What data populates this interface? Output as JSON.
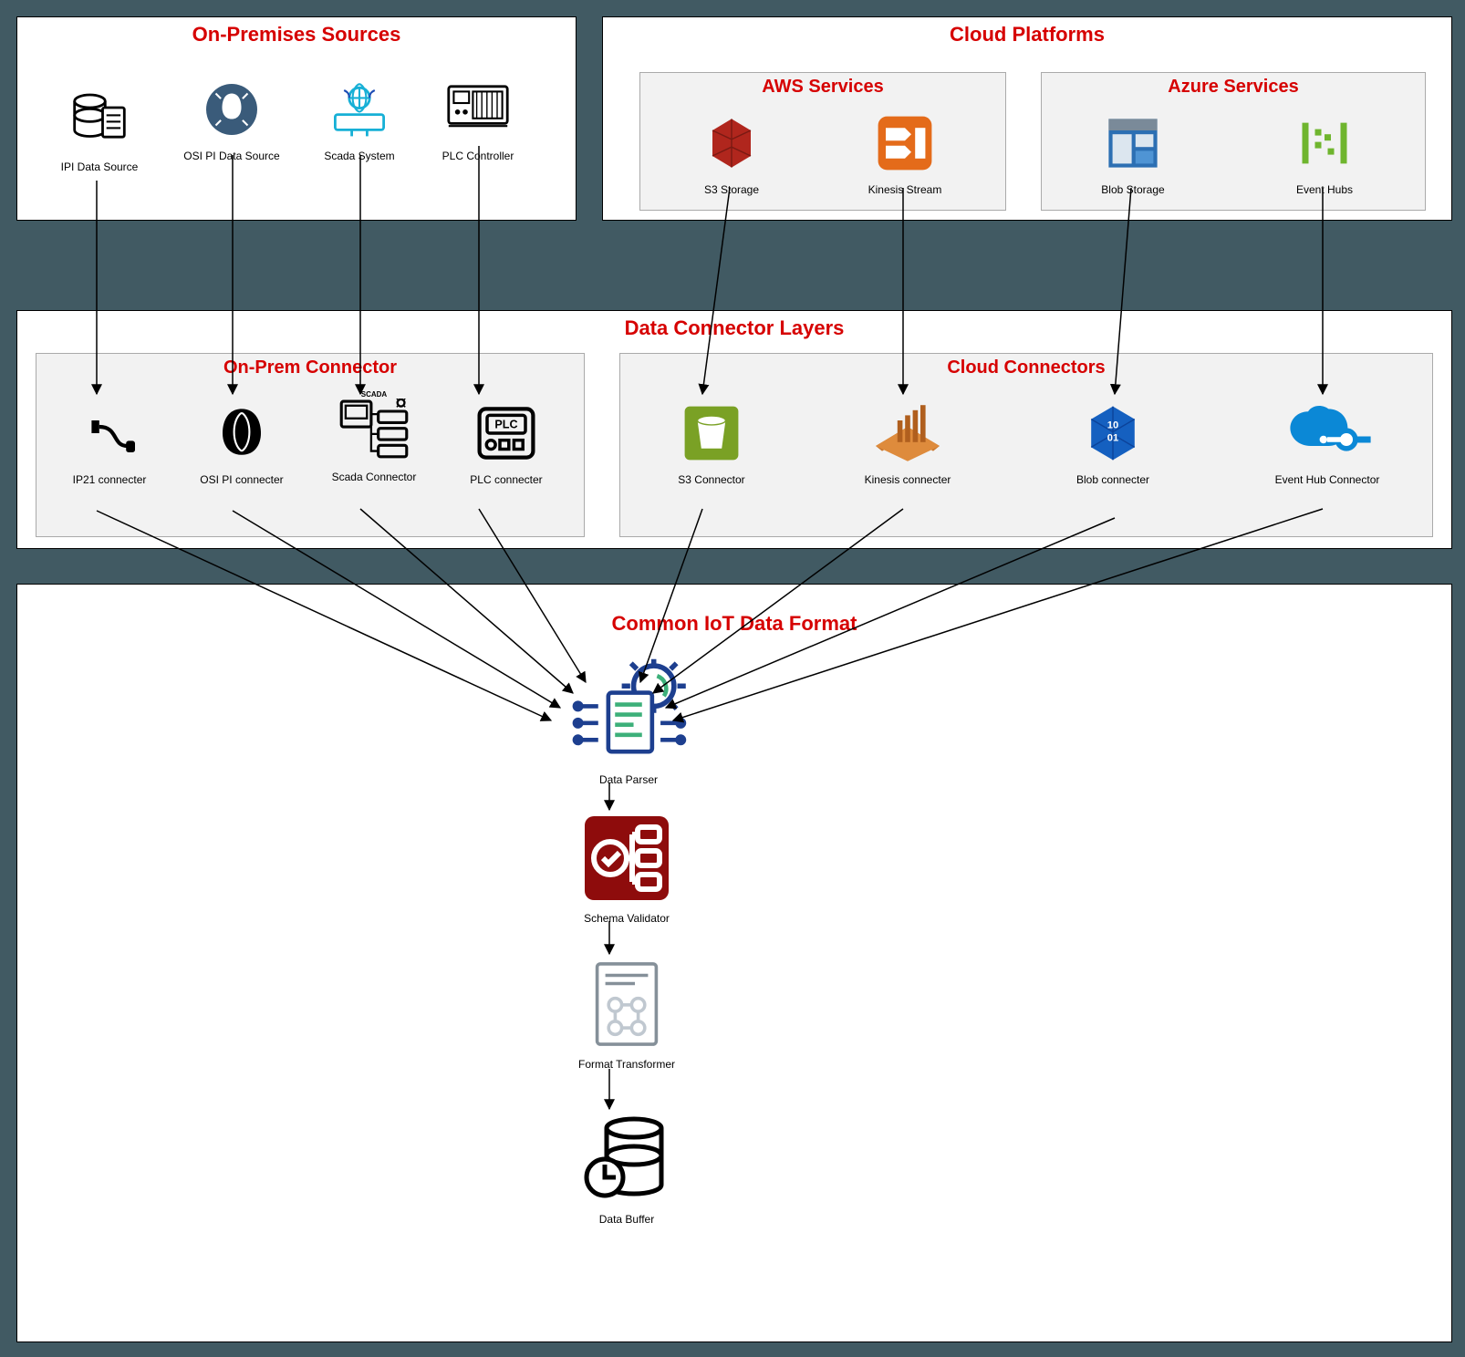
{
  "panels": {
    "onprem_sources": {
      "title": "On-Premises Sources"
    },
    "cloud_platforms": {
      "title": "Cloud Platforms"
    },
    "aws_services": {
      "title": "AWS Services"
    },
    "azure_services": {
      "title": "Azure Services"
    },
    "connector_layers": {
      "title": "Data Connector Layers"
    },
    "onprem_connector": {
      "title": "On-Prem Connector"
    },
    "cloud_connectors": {
      "title": "Cloud Connectors"
    },
    "common_format": {
      "title": "Common IoT Data Format"
    }
  },
  "onprem_sources": [
    {
      "id": "ipi-data-source",
      "label": "IPI Data Source",
      "icon": "db-doc"
    },
    {
      "id": "osi-pi-data-source",
      "label": "OSI PI Data Source",
      "icon": "osi-circle"
    },
    {
      "id": "scada-system",
      "label": "Scada System",
      "icon": "scada-globe"
    },
    {
      "id": "plc-controller",
      "label": "PLC Controller",
      "icon": "plc-panel"
    }
  ],
  "aws_services": [
    {
      "id": "s3-storage",
      "label": "S3 Storage",
      "icon": "s3"
    },
    {
      "id": "kinesis-stream",
      "label": "Kinesis Stream",
      "icon": "kinesis"
    }
  ],
  "azure_services": [
    {
      "id": "blob-storage",
      "label": "Blob Storage",
      "icon": "blob"
    },
    {
      "id": "event-hubs",
      "label": "Event Hubs",
      "icon": "event-hubs"
    }
  ],
  "onprem_connectors": [
    {
      "id": "ip21-connecter",
      "label": "IP21 connecter",
      "icon": "usb"
    },
    {
      "id": "osi-pi-connecter",
      "label": "OSI  PI connecter",
      "icon": "osi-leaf"
    },
    {
      "id": "scada-connector",
      "label": "Scada Connector",
      "icon": "scada-net"
    },
    {
      "id": "plc-connecter",
      "label": "PLC connecter",
      "icon": "plc"
    }
  ],
  "cloud_connectors": [
    {
      "id": "s3-connector",
      "label": "S3 Connector",
      "icon": "s3-bucket"
    },
    {
      "id": "kinesis-connecter",
      "label": "Kinesis connecter",
      "icon": "kinesis-conn"
    },
    {
      "id": "blob-connecter",
      "label": "Blob  connecter",
      "icon": "blob-conn"
    },
    {
      "id": "event-hub-connector",
      "label": "Event Hub Connector",
      "icon": "event-hub-conn"
    }
  ],
  "pipeline": [
    {
      "id": "data-parser",
      "label": "Data Parser",
      "icon": "parser"
    },
    {
      "id": "schema-validator",
      "label": "Schema Validator",
      "icon": "validator"
    },
    {
      "id": "format-transformer",
      "label": "Format Transformer",
      "icon": "transformer"
    },
    {
      "id": "data-buffer",
      "label": "Data Buffer",
      "icon": "buffer"
    }
  ]
}
